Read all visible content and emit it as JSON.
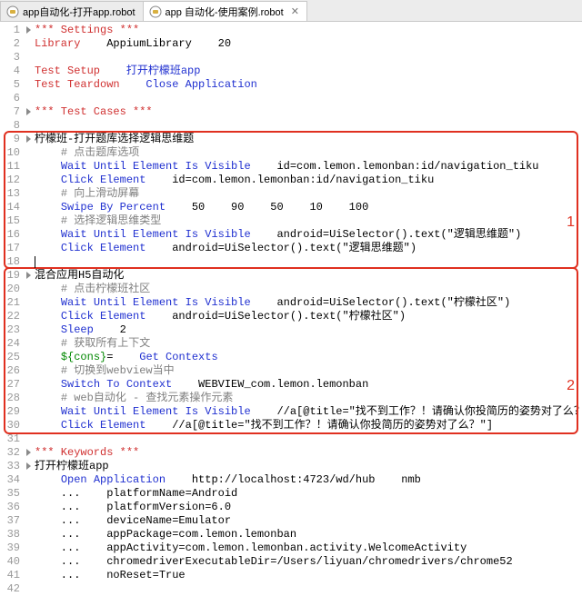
{
  "tabs": [
    {
      "label": "app自动化-打开app.robot",
      "active": false
    },
    {
      "label": "app 自动化-使用案例.robot",
      "active": true
    }
  ],
  "annotations": {
    "box1": "1",
    "box2": "2"
  },
  "code": [
    {
      "n": 1,
      "fold": true,
      "seg": [
        [
          "red",
          "*** Settings ***"
        ]
      ]
    },
    {
      "n": 2,
      "fold": false,
      "seg": [
        [
          "red",
          "Library    "
        ],
        [
          "black",
          "AppiumLibrary    20"
        ]
      ]
    },
    {
      "n": 3,
      "fold": false,
      "seg": []
    },
    {
      "n": 4,
      "fold": false,
      "seg": [
        [
          "red",
          "Test Setup    "
        ],
        [
          "blue",
          "打开柠檬班app"
        ]
      ]
    },
    {
      "n": 5,
      "fold": false,
      "seg": [
        [
          "red",
          "Test Teardown    "
        ],
        [
          "blue",
          "Close Application"
        ]
      ]
    },
    {
      "n": 6,
      "fold": false,
      "seg": []
    },
    {
      "n": 7,
      "fold": true,
      "seg": [
        [
          "red",
          "*** Test Cases ***"
        ]
      ]
    },
    {
      "n": 8,
      "fold": false,
      "seg": []
    },
    {
      "n": 9,
      "fold": true,
      "seg": [
        [
          "black",
          "柠檬班-打开题库选择逻辑思维题"
        ]
      ]
    },
    {
      "n": 10,
      "fold": false,
      "seg": [
        [
          "black",
          "    "
        ],
        [
          "gray",
          "# 点击题库选项"
        ]
      ]
    },
    {
      "n": 11,
      "fold": false,
      "seg": [
        [
          "black",
          "    "
        ],
        [
          "blue",
          "Wait Until Element Is Visible    "
        ],
        [
          "black",
          "id=com.lemon.lemonban:id/navigation_tiku"
        ]
      ]
    },
    {
      "n": 12,
      "fold": false,
      "seg": [
        [
          "black",
          "    "
        ],
        [
          "blue",
          "Click Element    "
        ],
        [
          "black",
          "id=com.lemon.lemonban:id/navigation_tiku"
        ]
      ]
    },
    {
      "n": 13,
      "fold": false,
      "seg": [
        [
          "black",
          "    "
        ],
        [
          "gray",
          "# 向上滑动屏幕"
        ]
      ]
    },
    {
      "n": 14,
      "fold": false,
      "seg": [
        [
          "black",
          "    "
        ],
        [
          "blue",
          "Swipe By Percent    "
        ],
        [
          "black",
          "50    90    50    10    100"
        ]
      ]
    },
    {
      "n": 15,
      "fold": false,
      "seg": [
        [
          "black",
          "    "
        ],
        [
          "gray",
          "# 选择逻辑思维类型"
        ]
      ]
    },
    {
      "n": 16,
      "fold": false,
      "seg": [
        [
          "black",
          "    "
        ],
        [
          "blue",
          "Wait Until Element Is Visible    "
        ],
        [
          "black",
          "android=UiSelector().text(\"逻辑思维题\")"
        ]
      ]
    },
    {
      "n": 17,
      "fold": false,
      "seg": [
        [
          "black",
          "    "
        ],
        [
          "blue",
          "Click Element    "
        ],
        [
          "black",
          "android=UiSelector().text(\"逻辑思维题\")"
        ]
      ]
    },
    {
      "n": 18,
      "fold": false,
      "seg": []
    },
    {
      "n": 19,
      "fold": true,
      "seg": [
        [
          "black",
          "混合应用H5自动化"
        ]
      ]
    },
    {
      "n": 20,
      "fold": false,
      "seg": [
        [
          "black",
          "    "
        ],
        [
          "gray",
          "# 点击柠檬班社区"
        ]
      ]
    },
    {
      "n": 21,
      "fold": false,
      "seg": [
        [
          "black",
          "    "
        ],
        [
          "blue",
          "Wait Until Element Is Visible    "
        ],
        [
          "black",
          "android=UiSelector().text(\"柠檬社区\")"
        ]
      ]
    },
    {
      "n": 22,
      "fold": false,
      "seg": [
        [
          "black",
          "    "
        ],
        [
          "blue",
          "Click Element    "
        ],
        [
          "black",
          "android=UiSelector().text(\"柠檬社区\")"
        ]
      ]
    },
    {
      "n": 23,
      "fold": false,
      "seg": [
        [
          "black",
          "    "
        ],
        [
          "blue",
          "Sleep    "
        ],
        [
          "black",
          "2"
        ]
      ]
    },
    {
      "n": 24,
      "fold": false,
      "seg": [
        [
          "black",
          "    "
        ],
        [
          "gray",
          "# 获取所有上下文"
        ]
      ]
    },
    {
      "n": 25,
      "fold": false,
      "seg": [
        [
          "black",
          "    "
        ],
        [
          "green",
          "${cons}"
        ],
        [
          "black",
          "=    "
        ],
        [
          "blue",
          "Get Contexts"
        ]
      ]
    },
    {
      "n": 26,
      "fold": false,
      "seg": [
        [
          "black",
          "    "
        ],
        [
          "gray",
          "# 切换到webview当中"
        ]
      ]
    },
    {
      "n": 27,
      "fold": false,
      "seg": [
        [
          "black",
          "    "
        ],
        [
          "blue",
          "Switch To Context    "
        ],
        [
          "black",
          "WEBVIEW_com.lemon.lemonban"
        ]
      ]
    },
    {
      "n": 28,
      "fold": false,
      "seg": [
        [
          "black",
          "    "
        ],
        [
          "gray",
          "# web自动化 - 查找元素操作元素"
        ]
      ]
    },
    {
      "n": 29,
      "fold": false,
      "seg": [
        [
          "black",
          "    "
        ],
        [
          "blue",
          "Wait Until Element Is Visible    "
        ],
        [
          "black",
          "//a[@title=\"找不到工作？！请确认你投简历的姿势对了么？\"]"
        ]
      ]
    },
    {
      "n": 30,
      "fold": false,
      "seg": [
        [
          "black",
          "    "
        ],
        [
          "blue",
          "Click Element    "
        ],
        [
          "black",
          "//a[@title=\"找不到工作？！请确认你投简历的姿势对了么？\"]"
        ]
      ]
    },
    {
      "n": 31,
      "fold": false,
      "seg": []
    },
    {
      "n": 32,
      "fold": true,
      "seg": [
        [
          "red",
          "*** Keywords ***"
        ]
      ]
    },
    {
      "n": 33,
      "fold": true,
      "seg": [
        [
          "black",
          "打开柠檬班app"
        ]
      ]
    },
    {
      "n": 34,
      "fold": false,
      "seg": [
        [
          "black",
          "    "
        ],
        [
          "blue",
          "Open Application    "
        ],
        [
          "black",
          "http://localhost:4723/wd/hub    nmb"
        ]
      ]
    },
    {
      "n": 35,
      "fold": false,
      "seg": [
        [
          "black",
          "    ...    platformName=Android"
        ]
      ]
    },
    {
      "n": 36,
      "fold": false,
      "seg": [
        [
          "black",
          "    ...    platformVersion=6.0"
        ]
      ]
    },
    {
      "n": 37,
      "fold": false,
      "seg": [
        [
          "black",
          "    ...    deviceName=Emulator"
        ]
      ]
    },
    {
      "n": 38,
      "fold": false,
      "seg": [
        [
          "black",
          "    ...    appPackage=com.lemon.lemonban"
        ]
      ]
    },
    {
      "n": 39,
      "fold": false,
      "seg": [
        [
          "black",
          "    ...    appActivity=com.lemon.lemonban.activity.WelcomeActivity"
        ]
      ]
    },
    {
      "n": 40,
      "fold": false,
      "seg": [
        [
          "black",
          "    ...    chromedriverExecutableDir=/Users/liyuan/chromedrivers/chrome52"
        ]
      ]
    },
    {
      "n": 41,
      "fold": false,
      "seg": [
        [
          "black",
          "    ...    noReset=True"
        ]
      ]
    },
    {
      "n": 42,
      "fold": false,
      "seg": []
    }
  ]
}
